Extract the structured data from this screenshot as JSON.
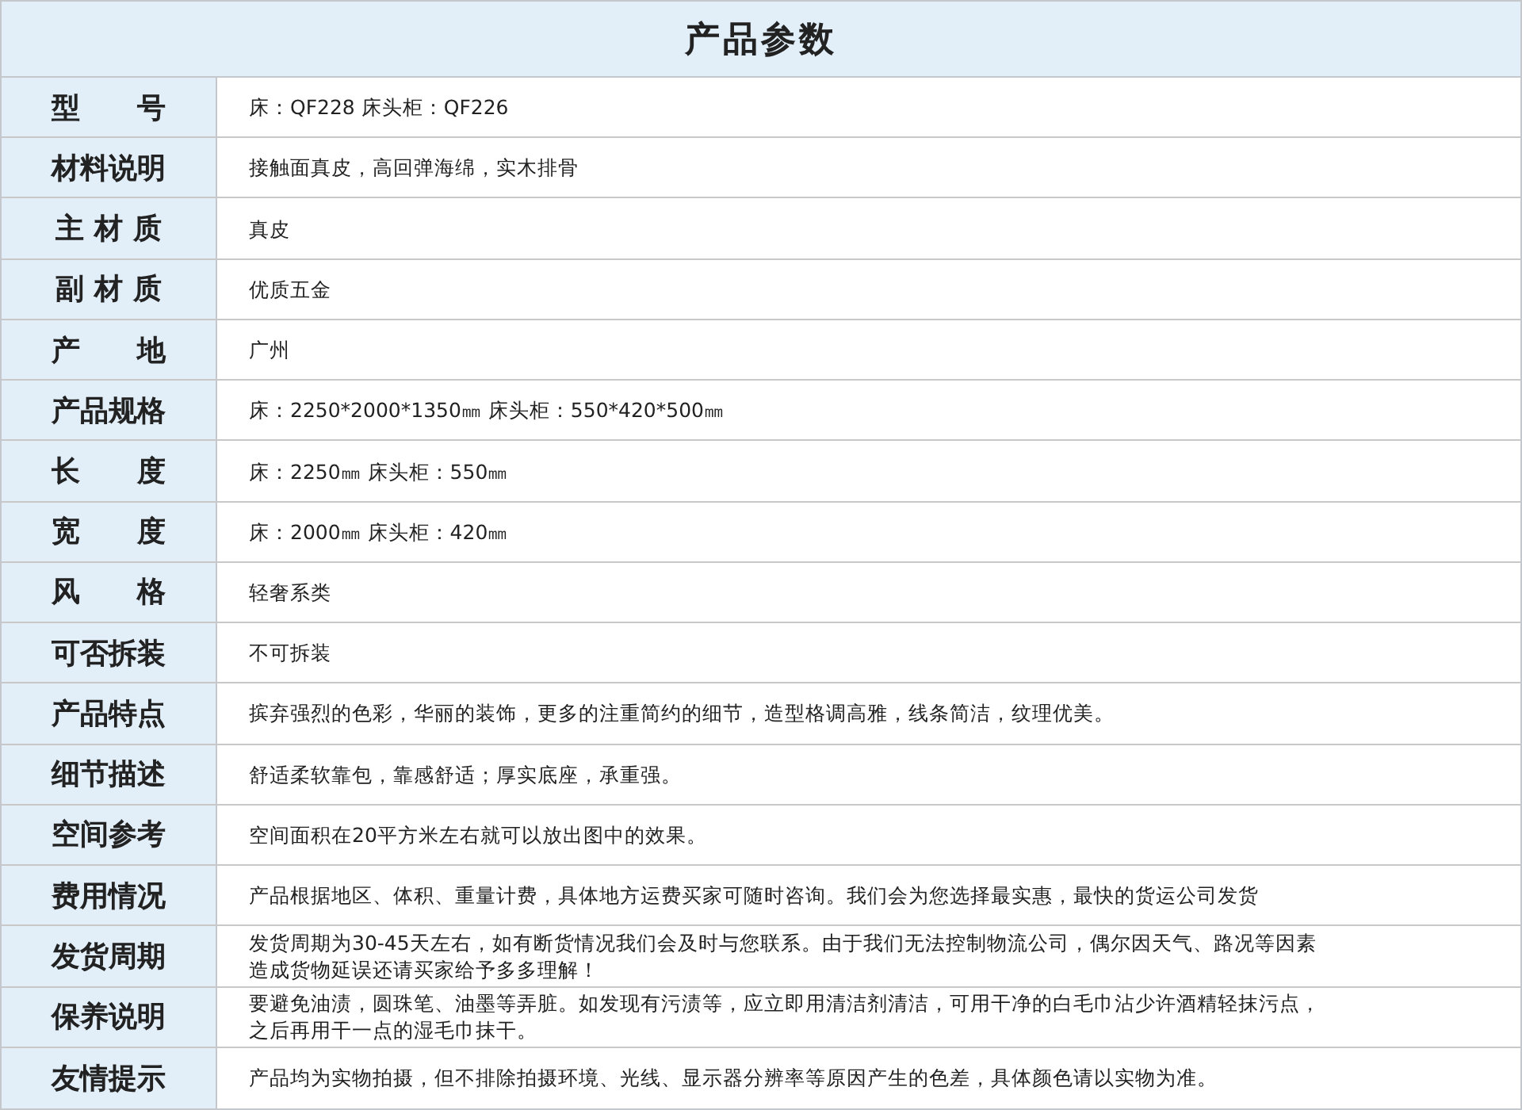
{
  "title": "产品参数",
  "rows": [
    {
      "label": "型　　号",
      "value": "床：QF228 床头柜：QF226"
    },
    {
      "label": "材料说明",
      "value": "接触面真皮，高回弹海绵，实木排骨"
    },
    {
      "label": "主 材 质",
      "value": "真皮"
    },
    {
      "label": "副 材 质",
      "value": "优质五金"
    },
    {
      "label": "产　　地",
      "value": "广州"
    },
    {
      "label": "产品规格",
      "value": "床：2250*2000*1350㎜  床头柜：550*420*500㎜"
    },
    {
      "label": "长　　度",
      "value": "床：2250㎜  床头柜：550㎜"
    },
    {
      "label": "宽　　度",
      "value": "床：2000㎜  床头柜：420㎜"
    },
    {
      "label": "风　　格",
      "value": "轻奢系类"
    },
    {
      "label": "可否拆装",
      "value": "不可拆装"
    },
    {
      "label": "产品特点",
      "value": "摈弃强烈的色彩，华丽的装饰，更多的注重简约的细节，造型格调高雅，线条简洁，纹理优美。"
    },
    {
      "label": "细节描述",
      "value": "舒适柔软靠包，靠感舒适；厚实底座，承重强。"
    },
    {
      "label": "空间参考",
      "value": "空间面积在20平方米左右就可以放出图中的效果。"
    },
    {
      "label": "费用情况",
      "value": "产品根据地区、体积、重量计费，具体地方运费买家可随时咨询。我们会为您选择最实惠，最快的货运公司发货"
    },
    {
      "label": "发货周期",
      "value": "发货周期为30-45天左右，如有断货情况我们会及时与您联系。由于我们无法控制物流公司，偶尔因天气、路况等因素造成货物延误还请买家给予多多理解！"
    },
    {
      "label": "保养说明",
      "value": "要避免油渍，圆珠笔、油墨等弄脏。如发现有污渍等，应立即用清洁剂清洁，可用干净的白毛巾沾少许酒精轻抹污点，之后再用干一点的湿毛巾抹干。"
    },
    {
      "label": "友情提示",
      "value": "产品均为实物拍摄，但不排除拍摄环境、光线、显示器分辨率等原因产生的色差，具体颜色请以实物为准。"
    }
  ]
}
